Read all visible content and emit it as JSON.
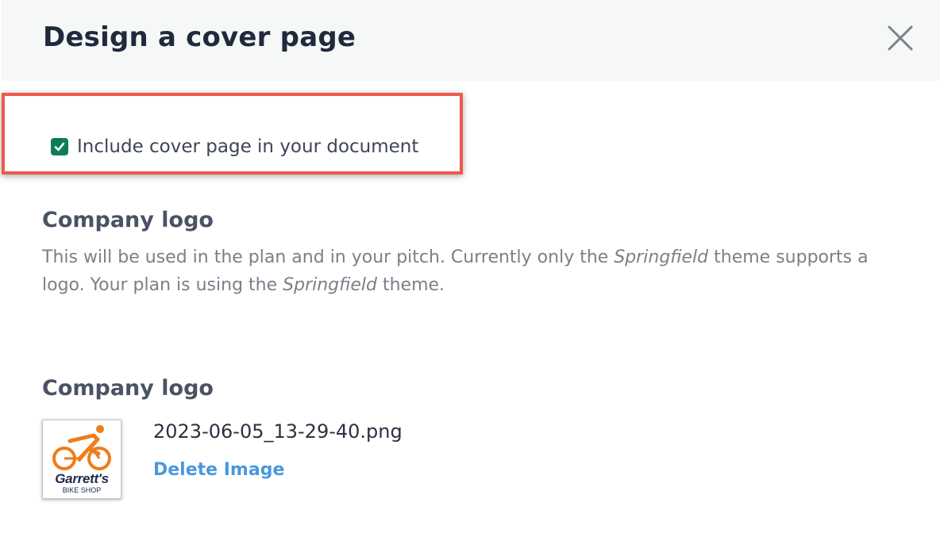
{
  "modal": {
    "title": "Design a cover page"
  },
  "cover_page": {
    "checkbox_checked": true,
    "checkbox_label": "Include cover page in your document"
  },
  "logo_info": {
    "title": "Company logo",
    "desc_part1": "This will be used in the plan and in your pitch. Currently only the ",
    "desc_theme_1": "Springfield",
    "desc_part2": " theme supports a logo. Your plan is using the ",
    "desc_theme_2": "Springfield",
    "desc_part3": " theme."
  },
  "logo_upload": {
    "title": "Company logo",
    "file_name": "2023-06-05_13-29-40.png",
    "delete_label": "Delete Image",
    "thumbnail": {
      "brand_name": "Garrett's",
      "brand_sub": "BIKE SHOP"
    }
  },
  "colors": {
    "highlight": "#ee5a4f",
    "checkbox": "#0b7d5a",
    "link": "#4a98de",
    "logo_orange": "#ef7d1a",
    "logo_navy": "#1e2a4a"
  },
  "icons": {
    "close": "close-icon",
    "checkmark": "checkmark-icon",
    "logo": "bicycle-rider-icon"
  }
}
